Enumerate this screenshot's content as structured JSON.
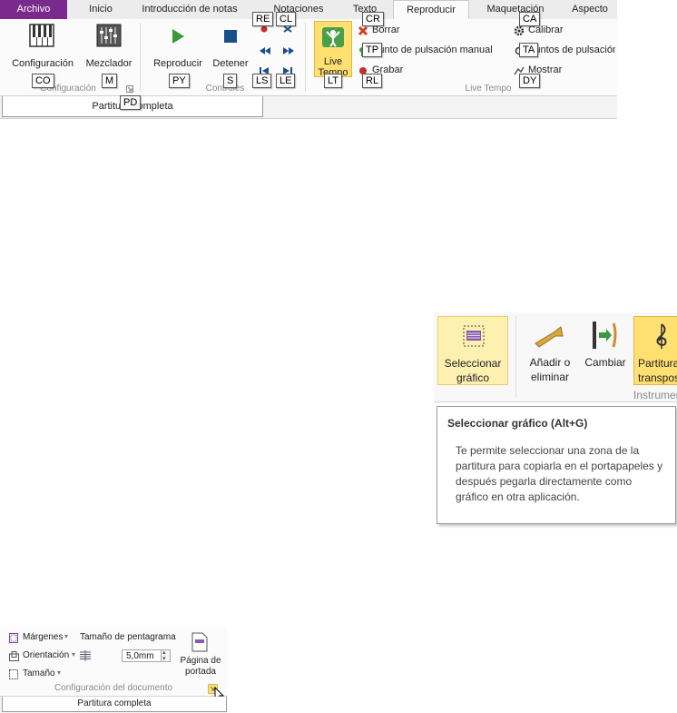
{
  "ribbon": {
    "tabs": [
      {
        "label": "Archivo",
        "state": "file"
      },
      {
        "label": "Inicio",
        "state": "normal"
      },
      {
        "label": "Introducción de notas",
        "state": "normal"
      },
      {
        "label": "Notaciones",
        "state": "normal"
      },
      {
        "label": "Texto",
        "state": "normal"
      },
      {
        "label": "Reproducir",
        "state": "active"
      },
      {
        "label": "Maquetación",
        "state": "normal"
      },
      {
        "label": "Aspecto",
        "state": "normal"
      }
    ],
    "groups": {
      "configuracion": {
        "label": "Configuración",
        "configuracion_button": "Configuración",
        "mezclador_button": "Mezclador"
      },
      "controles": {
        "label": "Controles",
        "reproducir_button": "Reproducir",
        "detener_button": "Detener"
      },
      "live_tempo": {
        "label": "Live Tempo",
        "live_tempo_button": "Live Tempo",
        "borrar": "Borrar",
        "punto_pulsacion_manual": "Punto de pulsación manual",
        "grabar": "Grabar",
        "calibrar": "Calibrar",
        "puntos_pulsacion": "Puntos de pulsación",
        "mostrar": "Mostrar"
      }
    },
    "keytips": {
      "co": "CO",
      "m": "M",
      "pd": "PD",
      "py": "PY",
      "s": "S",
      "re": "RE",
      "cl": "CL",
      "ls": "LS",
      "le": "LE",
      "lt": "LT",
      "cr": "CR",
      "tp": "TP",
      "rl": "RL",
      "ca": "CA",
      "ta": "TA",
      "dy": "DY"
    },
    "document_tab": "Partitura completa"
  },
  "tooltip_panel": {
    "buttons": {
      "seleccionar_grafico": "Seleccionar gráfico",
      "anadir_eliminar": "Añadir o eliminar",
      "cambiar": "Cambiar",
      "partitura_transpositora": "Partitura transpositora"
    },
    "group_label": "Instrumentos",
    "tooltip": {
      "title": "Seleccionar gráfico (Alt+G)",
      "description": "Te permite seleccionar una zona de la partitura para copiarla en el portapapeles y después pegarla directamente como gráfico en otra aplicación."
    }
  },
  "document_setup": {
    "margenes": "Márgenes",
    "orientacion": "Orientación",
    "tamano": "Tamaño",
    "tamano_pentagrama_label": "Tamaño de pentagrama",
    "tamano_pentagrama_value": "5,0mm",
    "pagina_portada": "Página de portada",
    "group_label": "Configuración del documento",
    "document_tab": "Partitura completa"
  },
  "colors": {
    "file_tab": "#7a2a8c",
    "live_tempo_highlight": "#ffe070",
    "play_green": "#3a9a3a",
    "stop_blue": "#1a4f8a"
  }
}
